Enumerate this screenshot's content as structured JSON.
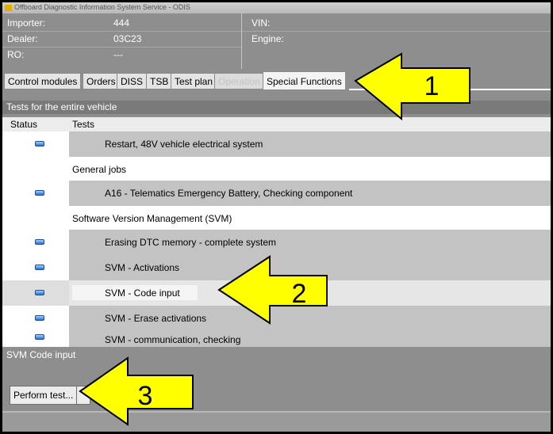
{
  "window": {
    "title": "Offboard Diagnostic Information System Service - ODIS"
  },
  "info": {
    "importer_label": "Importer:",
    "importer_value": "444",
    "dealer_label": "Dealer:",
    "dealer_value": "03C23",
    "ro_label": "RO:",
    "ro_value": "---",
    "vin_label": "VIN:",
    "engine_label": "Engine:"
  },
  "tabs": [
    {
      "label": "Control modules",
      "state": "normal"
    },
    {
      "label": "Orders",
      "state": "normal"
    },
    {
      "label": "DISS",
      "state": "normal"
    },
    {
      "label": "TSB",
      "state": "normal"
    },
    {
      "label": "Test plan",
      "state": "normal"
    },
    {
      "label": "Operation",
      "state": "disabled"
    },
    {
      "label": "Special Functions",
      "state": "active"
    }
  ],
  "section": {
    "title": "Tests for the entire vehicle"
  },
  "table": {
    "headers": {
      "status": "Status",
      "tests": "Tests"
    },
    "rows": [
      {
        "label": "Restart, 48V vehicle electrical system",
        "type": "test"
      },
      {
        "label": "General jobs",
        "type": "group"
      },
      {
        "label": "A16 - Telematics Emergency Battery, Checking component",
        "type": "test"
      },
      {
        "label": "Software Version Management (SVM)",
        "type": "group"
      },
      {
        "label": "Erasing DTC memory - complete system",
        "type": "test"
      },
      {
        "label": "SVM - Activations",
        "type": "test"
      },
      {
        "label": "SVM - Code input",
        "type": "test",
        "selected": true
      },
      {
        "label": "SVM - Erase activations",
        "type": "test"
      },
      {
        "label": "SVM - communication, checking",
        "type": "test"
      }
    ]
  },
  "detail": {
    "title": "SVM Code input",
    "perform_label": "Perform test..."
  },
  "annotations": {
    "a1": "1",
    "a2": "2",
    "a3": "3",
    "arrow_color": "#ffff00"
  },
  "icons": {
    "status": "status-indicator-icon"
  }
}
